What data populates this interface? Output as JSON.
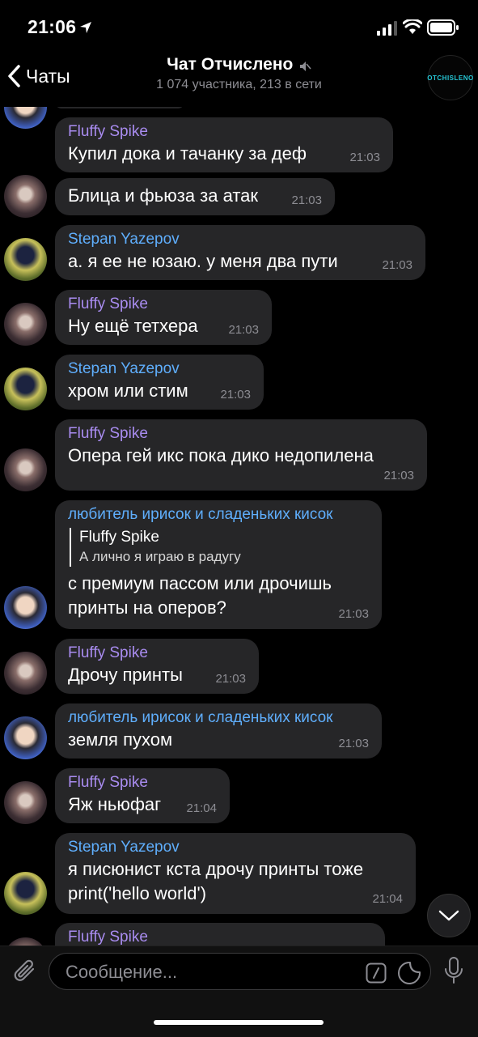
{
  "status": {
    "time": "21:06"
  },
  "header": {
    "back_label": "Чаты",
    "title": "Чат Отчислено",
    "subtitle": "1 074 участника, 213 в сети",
    "avatar_text": "OTCHISLENO"
  },
  "colors": {
    "fluffy_spike": "#a98cf0",
    "stepan": "#5faefc",
    "lover": "#5faefc",
    "bubble": "#262628"
  },
  "messages": [
    {
      "sender": "Fluffy Spike",
      "lines": [
        "Купил дока и тачанку за деф"
      ],
      "time": "21:03"
    },
    {
      "sender": "",
      "lines": [
        "Блица и фьюза за атак"
      ],
      "time": "21:03"
    },
    {
      "sender": "Stepan Yazepov",
      "lines": [
        "а. я ее не юзаю. у меня два пути"
      ],
      "time": "21:03"
    },
    {
      "sender": "Fluffy Spike",
      "lines": [
        "Ну ещё тетхера"
      ],
      "time": "21:03"
    },
    {
      "sender": "Stepan Yazepov",
      "lines": [
        "хром или стим"
      ],
      "time": "21:03"
    },
    {
      "sender": "Fluffy Spike",
      "lines": [
        "Опера гей икс пока дико недопилена"
      ],
      "time": "21:03"
    },
    {
      "sender": "любитель ирисок и сладеньких кисок",
      "reply": {
        "name": "Fluffy Spike",
        "text": "А лично я играю в радугу"
      },
      "lines": [
        "с премиум пассом или дрочишь",
        "принты на оперов?"
      ],
      "time": "21:03"
    },
    {
      "sender": "Fluffy Spike",
      "lines": [
        "Дрочу принты"
      ],
      "time": "21:03"
    },
    {
      "sender": "любитель ирисок и сладеньких кисок",
      "lines": [
        "земля пухом"
      ],
      "time": "21:03"
    },
    {
      "sender": "Fluffy Spike",
      "lines": [
        "Яж ньюфаг"
      ],
      "time": "21:04"
    },
    {
      "sender": "Stepan Yazepov",
      "lines": [
        "я писюнист кста дрочу принты тоже",
        "print('hello world')"
      ],
      "time": "21:04"
    },
    {
      "sender": "Fluffy Spike",
      "lines": [],
      "time": ""
    }
  ],
  "composer": {
    "placeholder": "Сообщение..."
  }
}
